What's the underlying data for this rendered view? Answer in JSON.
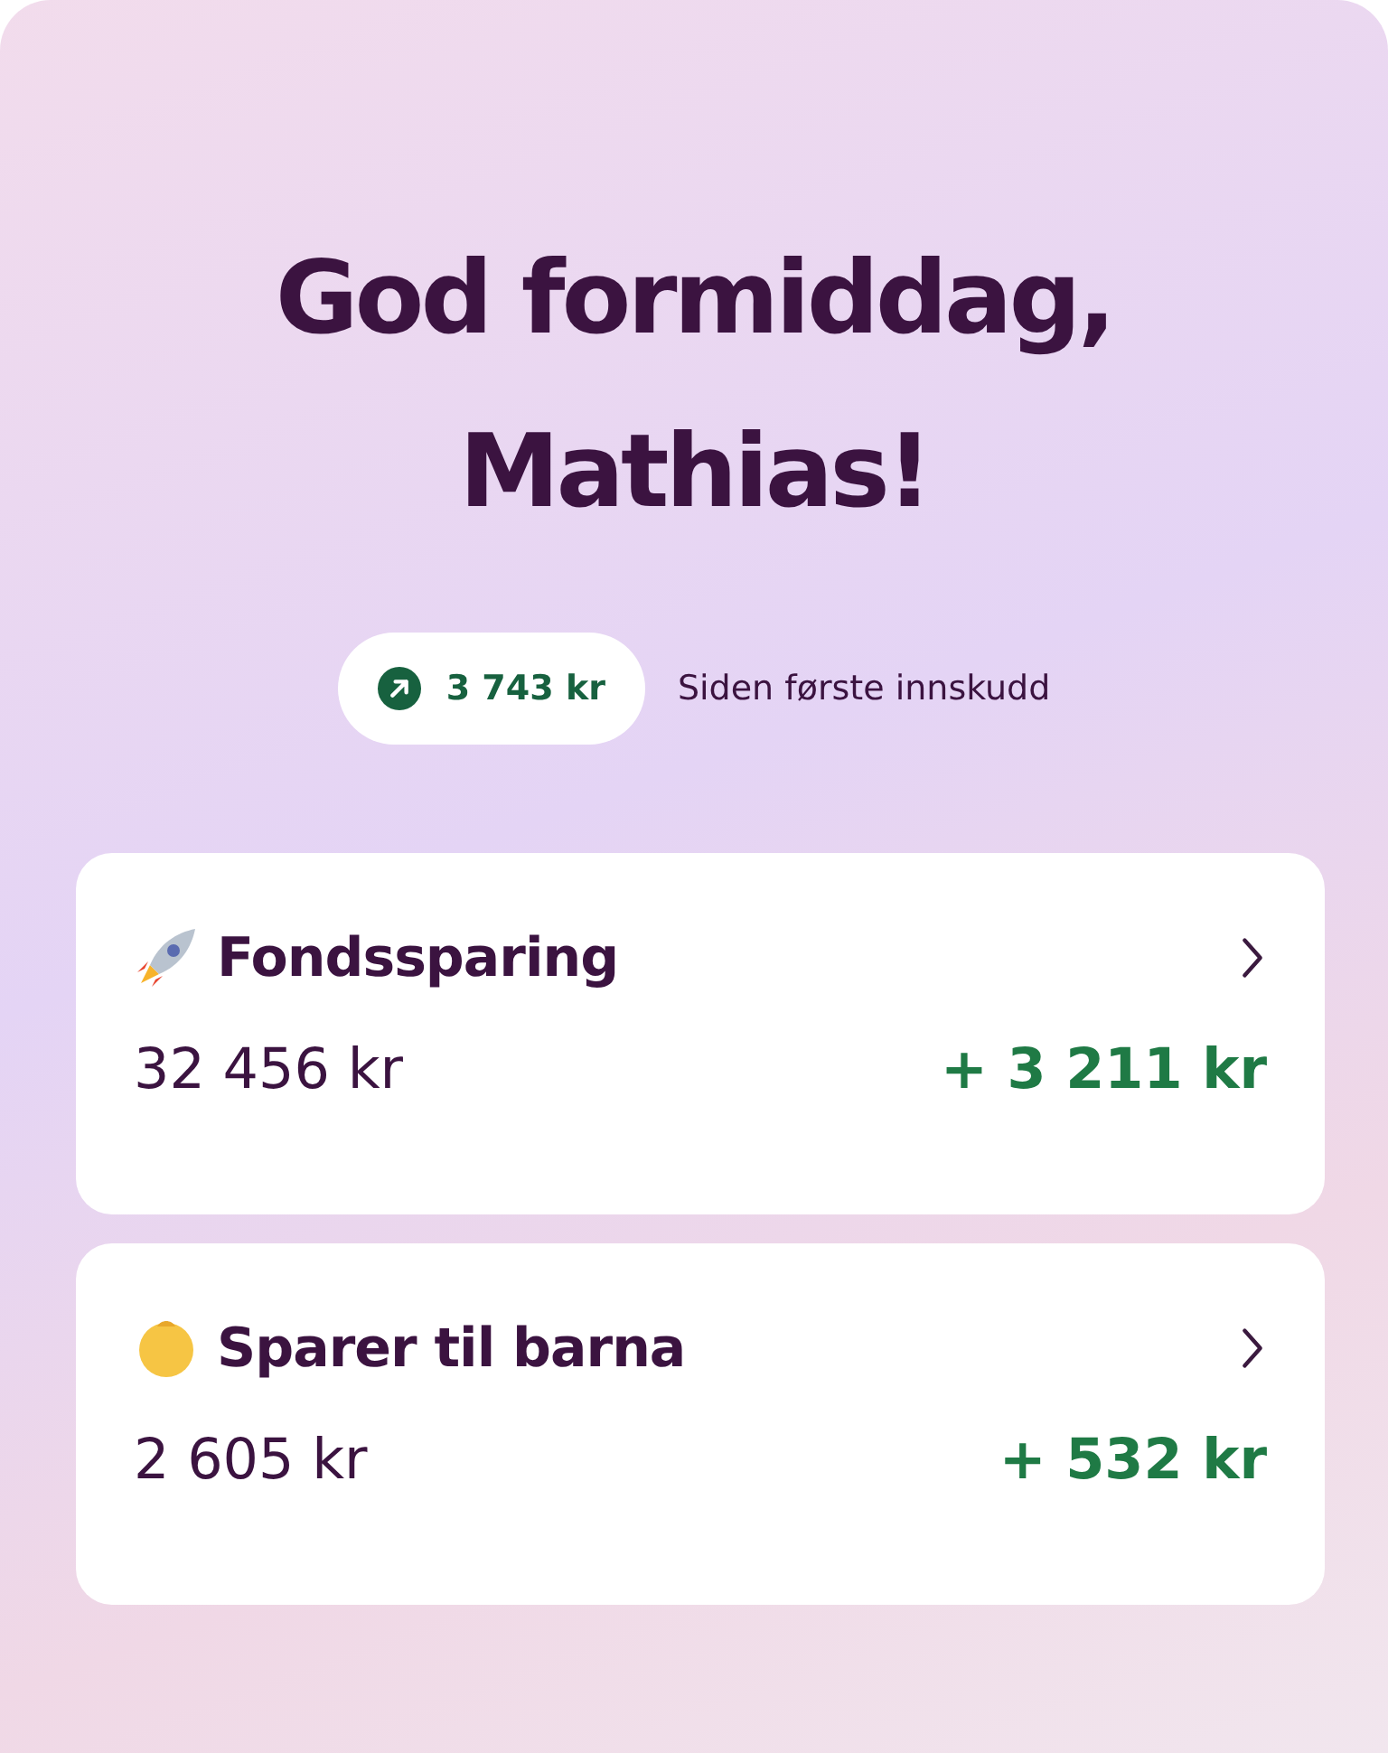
{
  "greeting": {
    "line_1": "God formiddag,",
    "line_2": "Mathias!"
  },
  "total": {
    "amount": "3 743 kr",
    "caption": "Siden første innskudd"
  },
  "accounts": [
    {
      "kind": "rocket",
      "title": "Fondssparing",
      "balance": "32 456  kr",
      "gain": "+ 3 211 kr"
    },
    {
      "kind": "baby",
      "title": "Sparer til barna",
      "balance": "2 605 kr",
      "gain": "+ 532 kr"
    }
  ]
}
